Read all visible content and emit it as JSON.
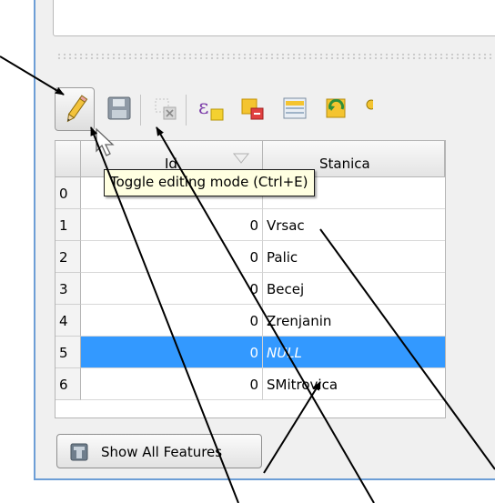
{
  "toolbar": {
    "toggle_editing_tooltip": "Toggle editing mode (Ctrl+E)",
    "icons": [
      "pencil-icon",
      "save-edits-icon",
      "delete-selected-icon",
      "expression-select-icon",
      "select-features-icon",
      "deselect-features-icon",
      "move-selection-top-icon",
      "invert-selection-icon"
    ]
  },
  "table": {
    "columns": [
      "Id",
      "Stanica"
    ],
    "rows": [
      {
        "num": "0",
        "id": "",
        "stanica": ""
      },
      {
        "num": "1",
        "id": "0",
        "stanica": "Vrsac"
      },
      {
        "num": "2",
        "id": "0",
        "stanica": "Palic"
      },
      {
        "num": "3",
        "id": "0",
        "stanica": "Becej"
      },
      {
        "num": "4",
        "id": "0",
        "stanica": "Zrenjanin"
      },
      {
        "num": "5",
        "id": "0",
        "stanica": "NULL"
      },
      {
        "num": "6",
        "id": "0",
        "stanica": "SMitrovica"
      }
    ],
    "selected_row": "5"
  },
  "footer": {
    "show_all_label": "Show All Features"
  },
  "colors": {
    "selection": "#3399ff",
    "panel_border": "#6d9ed6",
    "tooltip_bg": "#ffffe1"
  }
}
